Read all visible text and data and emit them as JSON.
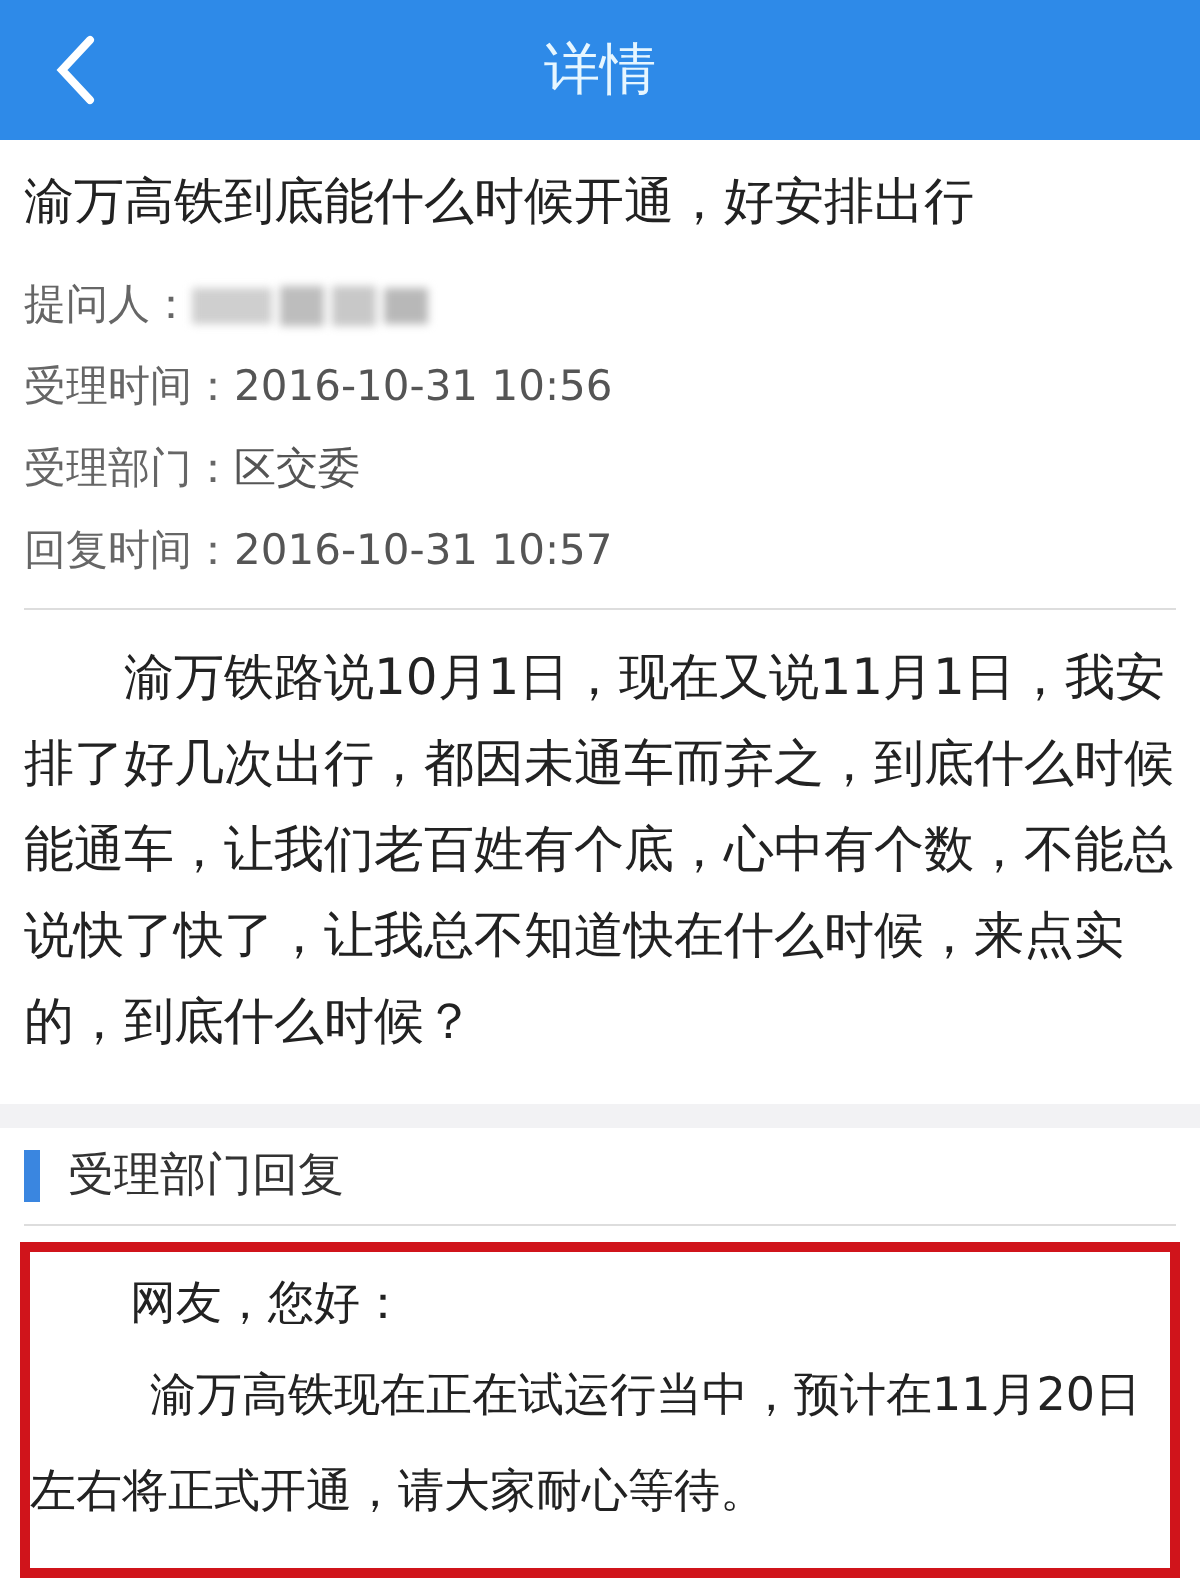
{
  "header": {
    "title": "详情"
  },
  "question": {
    "title": "渝万高铁到底能什么时候开通，好安排出行",
    "meta": [
      {
        "kind": "redacted",
        "label": "提问人："
      },
      {
        "kind": "text",
        "label": "受理时间：",
        "value": "2016-10-31 10:56"
      },
      {
        "kind": "text",
        "label": "受理部门：",
        "value": "区交委"
      },
      {
        "kind": "text",
        "label": "回复时间：",
        "value": "2016-10-31 10:57"
      }
    ],
    "body": "渝万铁路说10月1日，现在又说11月1日，我安排了好几次出行，都因未通车而弃之，到底什么时候能通车，让我们老百姓有个底，心中有个数，不能总说快了快了，让我总不知道快在什么时候，来点实的，到底什么时候？"
  },
  "reply": {
    "heading": "受理部门回复",
    "greeting": "网友，您好：",
    "body": "渝万高铁现在正在试运行当中，预计在11月20日左右将正式开通，请大家耐心等待。"
  }
}
